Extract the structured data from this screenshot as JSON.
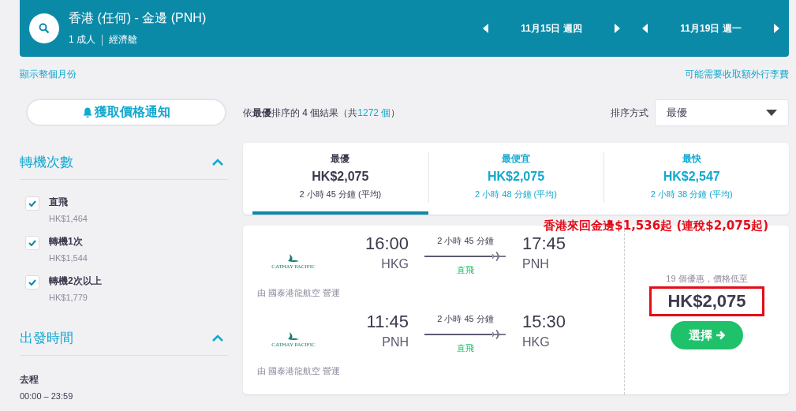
{
  "search_bar": {
    "route": "香港 (任何) - 金邊 (PNH)",
    "passengers": "1 成人",
    "cabin": "經濟艙",
    "dates": [
      {
        "label": "11月15日 週四"
      },
      {
        "label": "11月19日 週一"
      }
    ]
  },
  "links": {
    "left": "顯示整個月份",
    "right": "可能需要收取額外行李費"
  },
  "price_alert": {
    "label": "獲取價格通知"
  },
  "filters": [
    {
      "title": "轉機次數",
      "expanded": true,
      "options": [
        {
          "label": "直飛",
          "price": "HK$1,464",
          "checked": true
        },
        {
          "label": "轉機1次",
          "price": "HK$1,544",
          "checked": true
        },
        {
          "label": "轉機2次以上",
          "price": "HK$1,779",
          "checked": true
        }
      ]
    },
    {
      "title": "出發時間",
      "expanded": true,
      "ranges": [
        {
          "label": "去程",
          "value": "00:00 – 23:59"
        }
      ]
    }
  ],
  "results_summary": {
    "text": "依**最優**排序的 4 個結果（共",
    "count": "1272 個",
    "suffix": "）"
  },
  "sort": {
    "label": "排序方式",
    "value": "最優"
  },
  "sort_tabs": [
    {
      "label": "最優",
      "price": "HK$2,075",
      "duration": "2 小時 45 分鐘 (平均)",
      "selected": true
    },
    {
      "label": "最便宜",
      "price": "HK$2,075",
      "duration": "2 小時 48 分鐘 (平均)",
      "selected": false
    },
    {
      "label": "最快",
      "price": "HK$2,547",
      "duration": "2 小時 38 分鐘 (平均)",
      "selected": false
    }
  ],
  "annotation": "香港來回金邊$1,536起 (連稅$2,075起)",
  "result": {
    "legs": [
      {
        "airline": "CATHAY PACIFIC",
        "depart_time": "16:00",
        "depart_airport": "HKG",
        "duration": "2 小時 45 分鐘",
        "stops": "直飛",
        "arrive_time": "17:45",
        "arrive_airport": "PNH",
        "operated_by": "由 國泰港龍航空 營運"
      },
      {
        "airline": "CATHAY PACIFIC",
        "depart_time": "11:45",
        "depart_airport": "PNH",
        "duration": "2 小時 45 分鐘",
        "stops": "直飛",
        "arrive_time": "15:30",
        "arrive_airport": "HKG",
        "operated_by": "由 國泰港龍航空 營運"
      }
    ],
    "deals": "19 個優惠，價格低至",
    "price": "HK$2,075",
    "select": "選擇"
  }
}
